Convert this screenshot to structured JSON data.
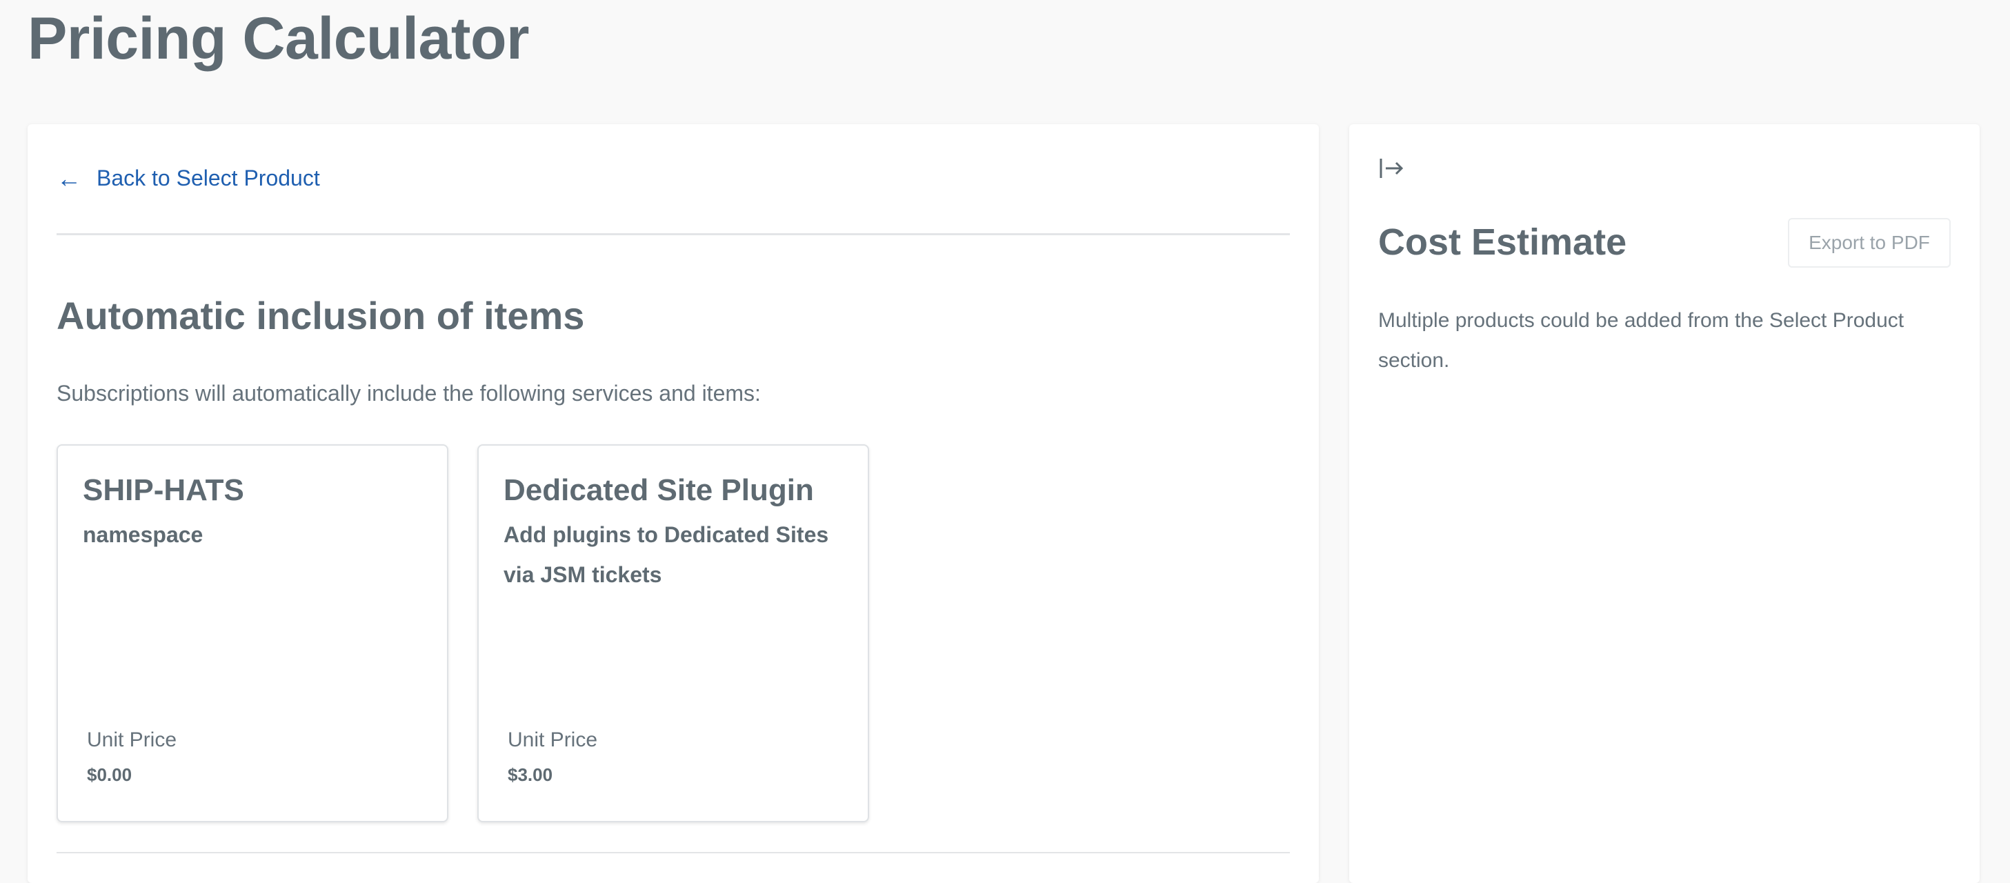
{
  "page": {
    "title": "Pricing Calculator"
  },
  "main": {
    "back_link": {
      "icon": "arrow-left-icon",
      "label": "Back to Select Product"
    },
    "section_heading": "Automatic inclusion of items",
    "section_description": "Subscriptions will automatically include the following services and items:",
    "cards": [
      {
        "title": "SHIP-HATS",
        "subtitle": "namespace",
        "price_label": "Unit Price",
        "price": "$0.00"
      },
      {
        "title": "Dedicated Site Plugin",
        "subtitle": "Add plugins to Dedicated Sites via JSM tickets",
        "price_label": "Unit Price",
        "price": "$3.00"
      }
    ]
  },
  "sidebar": {
    "collapse_icon": "collapse-panel-icon",
    "title": "Cost Estimate",
    "export_label": "Export to PDF",
    "description": "Multiple products could be added from the Select Product section."
  },
  "colors": {
    "link": "#1f5fb0",
    "heading": "#5e6a72",
    "background": "#f9f9f9",
    "panel": "#ffffff"
  }
}
